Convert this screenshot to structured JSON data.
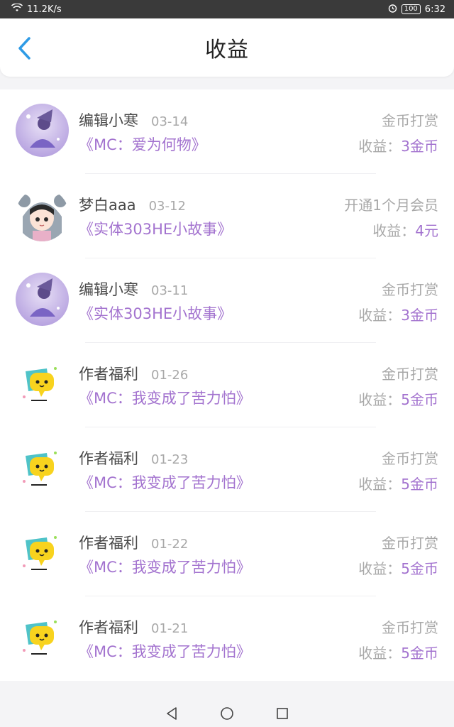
{
  "status_bar": {
    "network_speed": "11.2K/s",
    "battery": "100",
    "time": "6:32"
  },
  "header": {
    "title": "收益"
  },
  "income_list": [
    {
      "name": "编辑小寒",
      "date": "03-14",
      "book": "《MC：爱为何物》",
      "type": "金币打赏",
      "earn_label": "收益：",
      "earn_amount": "3金币",
      "avatar": "anime-girl-purple-avatar"
    },
    {
      "name": "梦白aaa",
      "date": "03-12",
      "book": "《实体303HE小故事》",
      "type": "开通1个月会员",
      "earn_label": "收益：",
      "earn_amount": "4元",
      "avatar": "koala-hood-girl-avatar"
    },
    {
      "name": "编辑小寒",
      "date": "03-11",
      "book": "《实体303HE小故事》",
      "type": "金币打赏",
      "earn_label": "收益：",
      "earn_amount": "3金币",
      "avatar": "anime-girl-purple-avatar"
    },
    {
      "name": "作者福利",
      "date": "01-26",
      "book": "《MC：我变成了苦力怕》",
      "type": "金币打赏",
      "earn_label": "收益：",
      "earn_amount": "5金币",
      "avatar": "chat-bubble-avatar"
    },
    {
      "name": "作者福利",
      "date": "01-23",
      "book": "《MC：我变成了苦力怕》",
      "type": "金币打赏",
      "earn_label": "收益：",
      "earn_amount": "5金币",
      "avatar": "chat-bubble-avatar"
    },
    {
      "name": "作者福利",
      "date": "01-22",
      "book": "《MC：我变成了苦力怕》",
      "type": "金币打赏",
      "earn_label": "收益：",
      "earn_amount": "5金币",
      "avatar": "chat-bubble-avatar"
    },
    {
      "name": "作者福利",
      "date": "01-21",
      "book": "《MC：我变成了苦力怕》",
      "type": "金币打赏",
      "earn_label": "收益：",
      "earn_amount": "5金币",
      "avatar": "chat-bubble-avatar"
    }
  ],
  "colors": {
    "accent": "#a373cf",
    "back_arrow": "#2f9be6",
    "muted": "#a8a8a8"
  }
}
